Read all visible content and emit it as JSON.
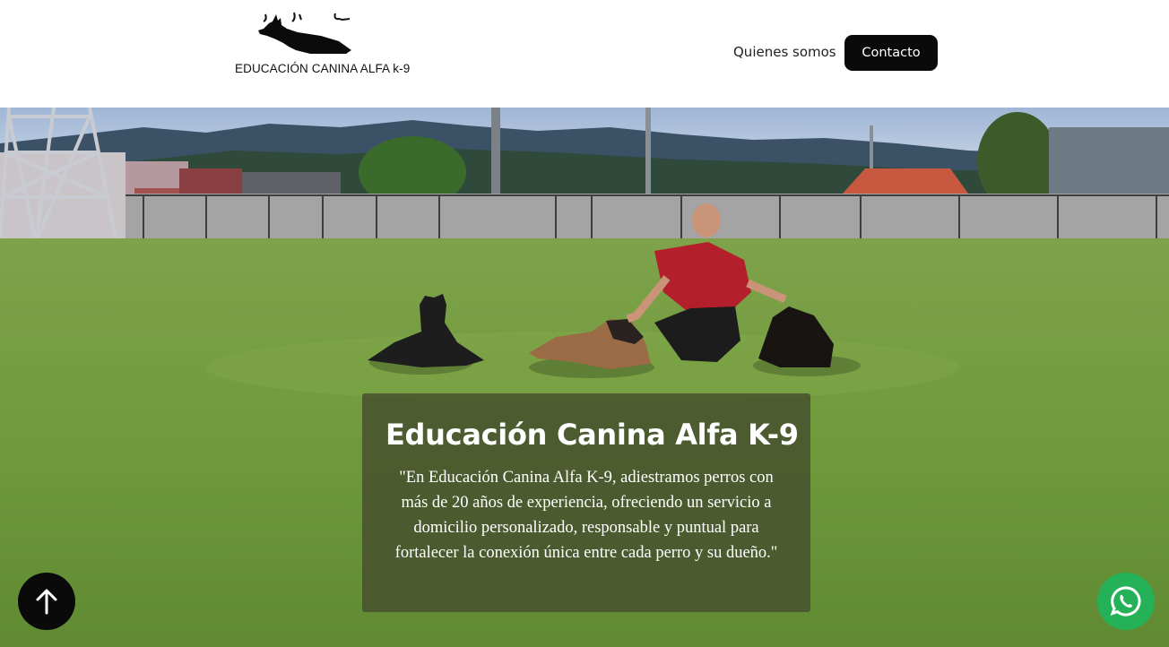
{
  "header": {
    "logo_text": "EDUCACIÓN CANINA ALFA k-9",
    "nav": {
      "about_label": "Quienes somos",
      "contact_label": "Contacto"
    }
  },
  "hero": {
    "title": "Educación Canina Alfa K-9",
    "description": "\"En Educación Canina Alfa K-9, adiestramos perros con más de 20 años de experiencia, ofreciendo un servicio a domicilio personalizado, responsable y puntual para fortalecer la conexión única entre cada perro y su dueño.\""
  },
  "floating": {
    "scroll_top_icon": "arrow-up-icon",
    "whatsapp_icon": "whatsapp-icon"
  },
  "colors": {
    "cta_background": "#0a0a0a",
    "card_overlay": "#464e2d",
    "whatsapp_green": "#25b157",
    "grass": "#6f9a3c"
  }
}
